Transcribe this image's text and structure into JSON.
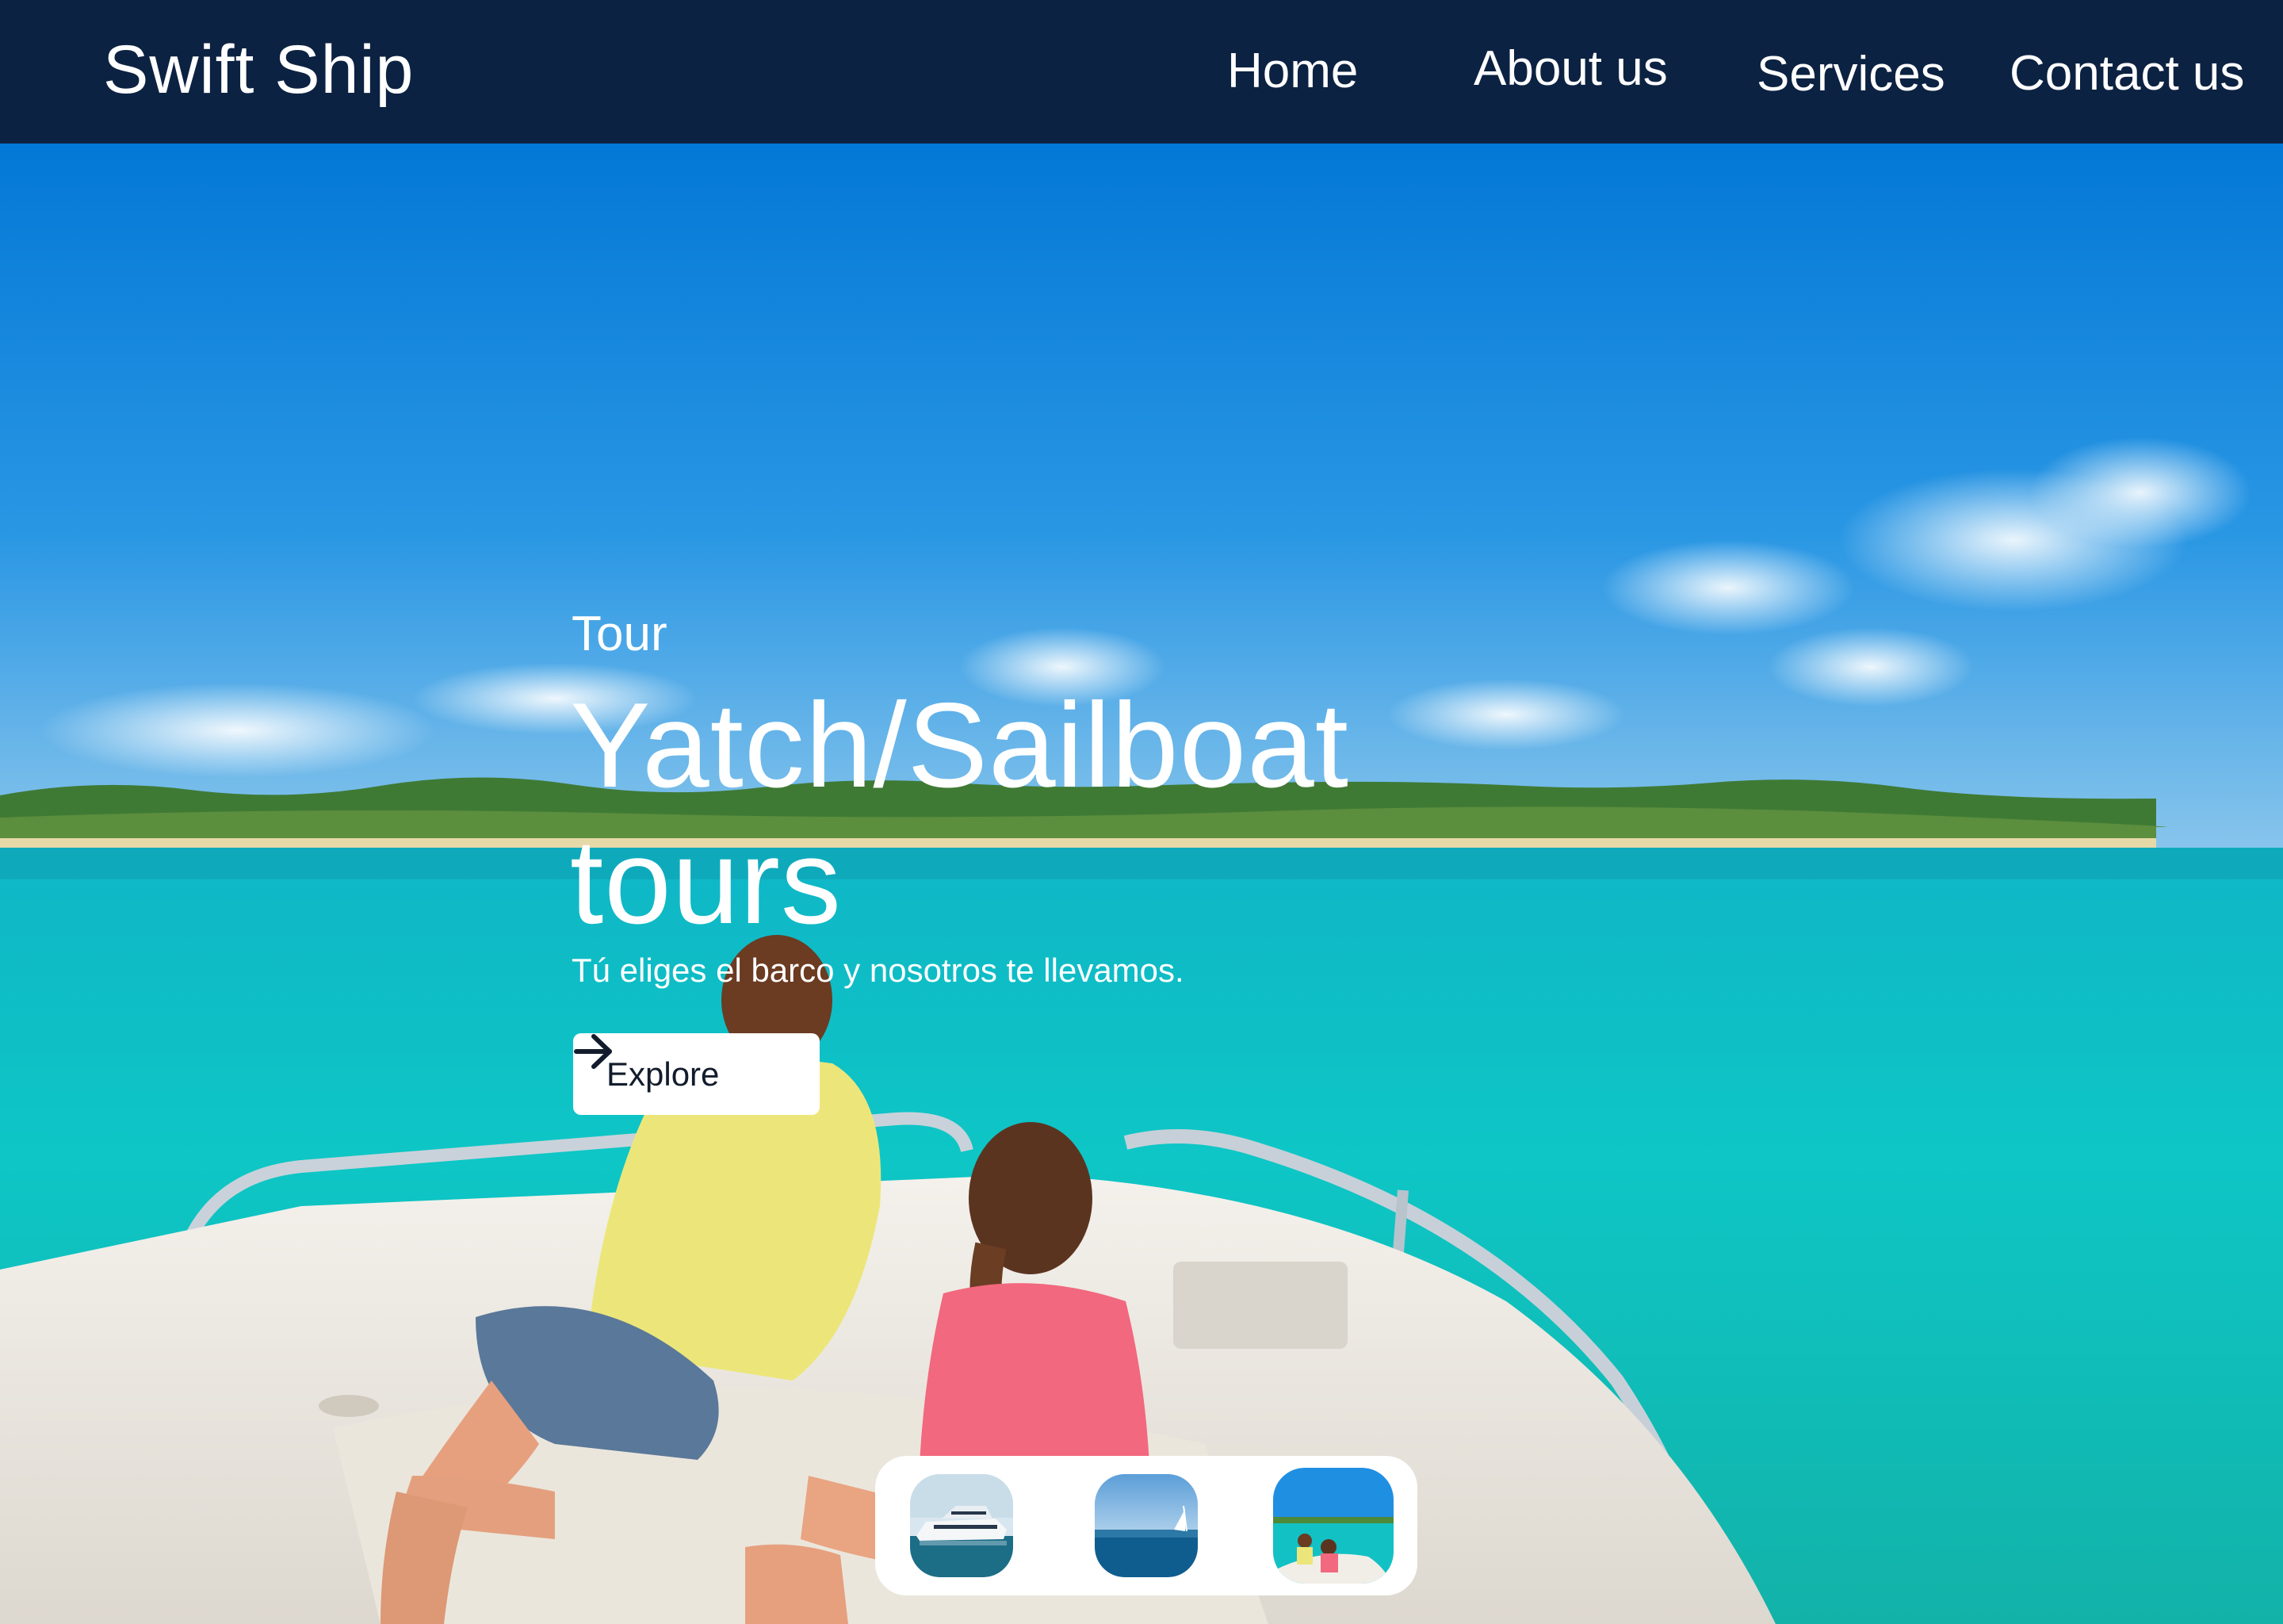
{
  "header": {
    "brand": "Swift Ship",
    "nav": [
      {
        "label": "Home"
      },
      {
        "label": "About us"
      },
      {
        "label": "Services"
      },
      {
        "label": "Contact us"
      }
    ]
  },
  "hero": {
    "eyebrow": "Tour",
    "headline": "Yatch/Sailboat tours",
    "subtitle": "Tú eliges el barco y nosotros te llevamos.",
    "cta": {
      "label": "Explore",
      "icon": "arrow-right-icon"
    },
    "thumbnails": [
      {
        "name": "yacht-thumbnail"
      },
      {
        "name": "sailboat-thumbnail"
      },
      {
        "name": "kids-on-boat-thumbnail"
      }
    ]
  },
  "colors": {
    "navbar": "#0c2242",
    "sky": "#1a8ee0",
    "sea": "#0cc3c4",
    "button": "#ffffff",
    "button_text": "#121c2c"
  }
}
